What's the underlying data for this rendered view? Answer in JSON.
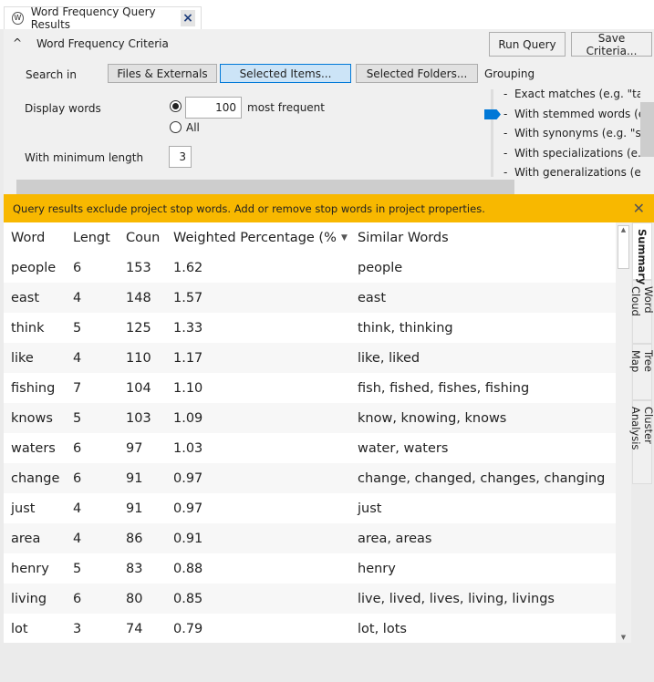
{
  "tab": {
    "title": "Word Frequency Query Results",
    "close": "×"
  },
  "criteria": {
    "title": "Word Frequency Criteria",
    "run": "Run Query",
    "save": "Save Criteria...",
    "search_in": "Search in",
    "files": "Files & Externals",
    "items": "Selected Items...",
    "folders": "Selected Folders...",
    "display_words": "Display words",
    "count": "100",
    "most_frequent": "most frequent",
    "all": "All",
    "min_length_label": "With minimum length",
    "min_length": "3",
    "grouping": "Grouping",
    "grouping_options": [
      "Exact matches (e.g. \"talk\"",
      "With stemmed words (e.g",
      "With synonyms (e.g. \"spe",
      "With specializations (e.g.",
      "With generalizations (e.g."
    ],
    "grouping_selected": 1
  },
  "warning": "Query results exclude project stop words. Add or remove stop words in project properties.",
  "table": {
    "headers": [
      "Word",
      "Lengt",
      "Coun",
      "Weighted Percentage (%",
      "Similar Words"
    ],
    "rows": [
      [
        "people",
        "6",
        "153",
        "1.62",
        "people"
      ],
      [
        "east",
        "4",
        "148",
        "1.57",
        "east"
      ],
      [
        "think",
        "5",
        "125",
        "1.33",
        "think, thinking"
      ],
      [
        "like",
        "4",
        "110",
        "1.17",
        "like, liked"
      ],
      [
        "fishing",
        "7",
        "104",
        "1.10",
        "fish, fished, fishes, fishing"
      ],
      [
        "knows",
        "5",
        "103",
        "1.09",
        "know, knowing, knows"
      ],
      [
        "waters",
        "6",
        "97",
        "1.03",
        "water, waters"
      ],
      [
        "change",
        "6",
        "91",
        "0.97",
        "change, changed, changes, changing"
      ],
      [
        "just",
        "4",
        "91",
        "0.97",
        "just"
      ],
      [
        "area",
        "4",
        "86",
        "0.91",
        "area, areas"
      ],
      [
        "henry",
        "5",
        "83",
        "0.88",
        "henry"
      ],
      [
        "living",
        "6",
        "80",
        "0.85",
        "live, lived, lives, living, livings"
      ],
      [
        "lot",
        "3",
        "74",
        "0.79",
        "lot, lots"
      ]
    ]
  },
  "side_tabs": [
    "Summary",
    "Word Cloud",
    "Tree Map",
    "Cluster Analysis"
  ],
  "colors": {
    "warning": "#f8b800",
    "accent": "#0078d7"
  }
}
